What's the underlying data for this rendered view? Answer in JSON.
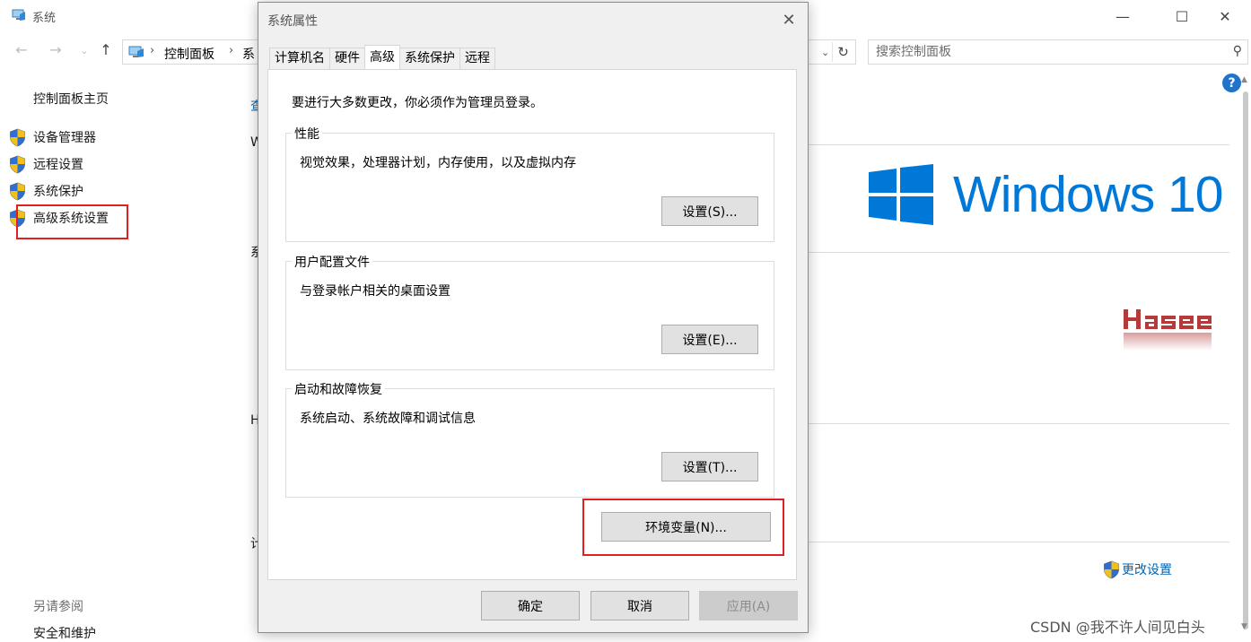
{
  "bg_window": {
    "title": "系统",
    "address": {
      "crumb1": "控制面板",
      "crumb2": "系"
    },
    "search_placeholder": "搜索控制面板",
    "sidebar": {
      "home": "控制面板主页",
      "items": [
        {
          "label": "设备管理器",
          "icon": "shield-icon"
        },
        {
          "label": "远程设置",
          "icon": "shield-icon"
        },
        {
          "label": "系统保护",
          "icon": "shield-icon"
        },
        {
          "label": "高级系统设置",
          "icon": "shield-icon"
        }
      ],
      "see_also": "另请参阅",
      "security": "安全和维护"
    },
    "help": "?",
    "brand": {
      "windows_text": "Windows 10",
      "oem_logo": "HASEE"
    },
    "change_settings": "更改设置",
    "peek": {
      "p1": "查",
      "p2": "W",
      "p3": "系",
      "p4": "H",
      "p5": "计"
    },
    "watermark": "CSDN @我不许人间见白头"
  },
  "dialog": {
    "title": "系统属性",
    "tabs": [
      "计算机名",
      "硬件",
      "高级",
      "系统保护",
      "远程"
    ],
    "active_tab": "高级",
    "admin_note": "要进行大多数更改，你必须作为管理员登录。",
    "groups": [
      {
        "title": "性能",
        "desc": "视觉效果，处理器计划，内存使用，以及虚拟内存",
        "button": "设置(S)..."
      },
      {
        "title": "用户配置文件",
        "desc": "与登录帐户相关的桌面设置",
        "button": "设置(E)..."
      },
      {
        "title": "启动和故障恢复",
        "desc": "系统启动、系统故障和调试信息",
        "button": "设置(T)..."
      }
    ],
    "env_button": "环境变量(N)...",
    "ok": "确定",
    "cancel": "取消",
    "apply": "应用(A)"
  },
  "colors": {
    "accent": "#0078d7",
    "link": "#0063b1",
    "highlight_red": "#e02020",
    "dialog_bg": "#f0f0f0",
    "button_bg": "#e1e1e1"
  }
}
